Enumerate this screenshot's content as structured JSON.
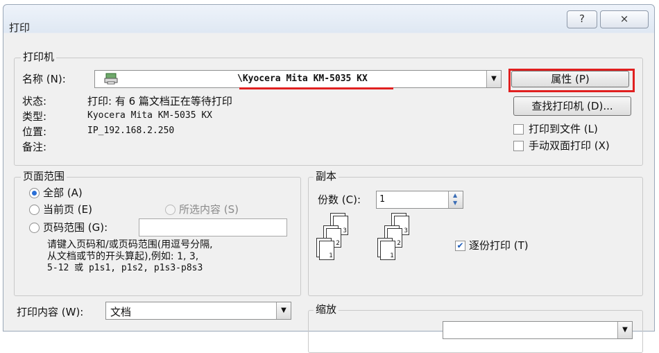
{
  "window": {
    "title": "打印",
    "help_glyph": "?",
    "close_glyph": "⨯"
  },
  "printer": {
    "group_title": "打印机",
    "name_label": "名称 (N):",
    "name_value": "\\Kyocera Mita KM-5035 KX",
    "status_label": "状态:",
    "status_value": "打印: 有 6 篇文档正在等待打印",
    "type_label": "类型:",
    "type_value": "Kyocera Mita KM-5035 KX",
    "location_label": "位置:",
    "location_value": "IP_192.168.2.250",
    "comment_label": "备注:",
    "properties_button": "属性 (P)",
    "find_printer_button": "查找打印机 (D)...",
    "print_to_file_label": "打印到文件 (L)",
    "manual_duplex_label": "手动双面打印 (X)",
    "print_to_file_checked": false,
    "manual_duplex_checked": false,
    "highlight_color": "#e02020"
  },
  "page_range": {
    "group_title": "页面范围",
    "all_label": "全部 (A)",
    "current_label": "当前页 (E)",
    "selection_label": "所选内容 (S)",
    "pages_label": "页码范围 (G):",
    "pages_value": "",
    "hint_line1": "请键入页码和/或页码范围(用逗号分隔,",
    "hint_line2": "从文档或节的开头算起),例如: 1, 3,",
    "hint_line3": "5-12 或 p1s1, p1s2, p1s3-p8s3",
    "selected": "all"
  },
  "copies": {
    "group_title": "副本",
    "count_label": "份数 (C):",
    "count_value": "1",
    "collate_label": "逐份打印 (T)",
    "collate_checked": true,
    "page_numbers": [
      "1",
      "2",
      "3"
    ]
  },
  "print_what": {
    "label": "打印内容 (W):",
    "value": "文档"
  },
  "zoom": {
    "group_title": "缩放"
  }
}
